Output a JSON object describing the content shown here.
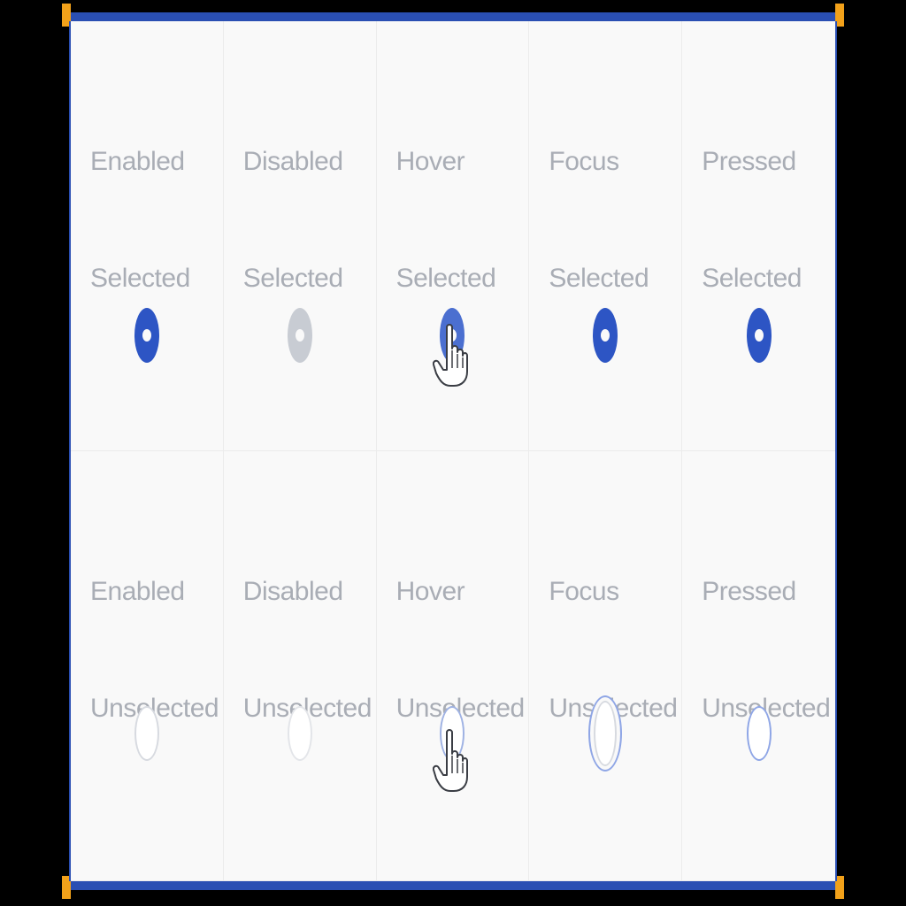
{
  "grid": {
    "row1": [
      {
        "state": "Enabled",
        "selection": "Selected"
      },
      {
        "state": "Disabled",
        "selection": "Selected"
      },
      {
        "state": "Hover",
        "selection": "Selected"
      },
      {
        "state": "Focus",
        "selection": "Selected"
      },
      {
        "state": "Pressed",
        "selection": "Selected"
      }
    ],
    "row2": [
      {
        "state": "Enabled",
        "selection": "Unselected"
      },
      {
        "state": "Disabled",
        "selection": "Unselected"
      },
      {
        "state": "Hover",
        "selection": "Unselected"
      },
      {
        "state": "Focus",
        "selection": "Unselected"
      },
      {
        "state": "Pressed",
        "selection": "Unselected"
      }
    ]
  },
  "colors": {
    "accent": "#2d55c4",
    "frame": "#2a4fb3",
    "handle": "#f2a11a",
    "label": "#a9adb5",
    "disabled": "#c8ccd3"
  },
  "icons": {
    "cursor": "hand-pointer-icon"
  }
}
